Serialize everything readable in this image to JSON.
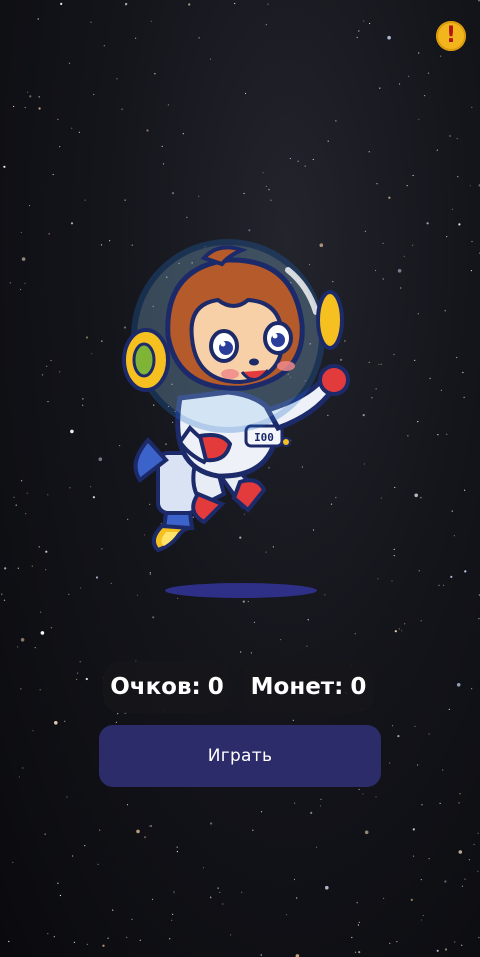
{
  "colors": {
    "background": "#111217",
    "play_button": "#2d2c6b",
    "stat_pill": "#16161a",
    "alert_badge": "#f2b51c",
    "shadow": "#2e2f86"
  },
  "alert": {
    "icon": "exclamation-icon",
    "glyph": "!"
  },
  "mascot": {
    "name": "astronaut-monkey"
  },
  "stats": {
    "score_label": "Очков:",
    "score_value": "0",
    "coins_label": "Монет:",
    "coins_value": "0"
  },
  "play_button": {
    "label": "Играть"
  }
}
